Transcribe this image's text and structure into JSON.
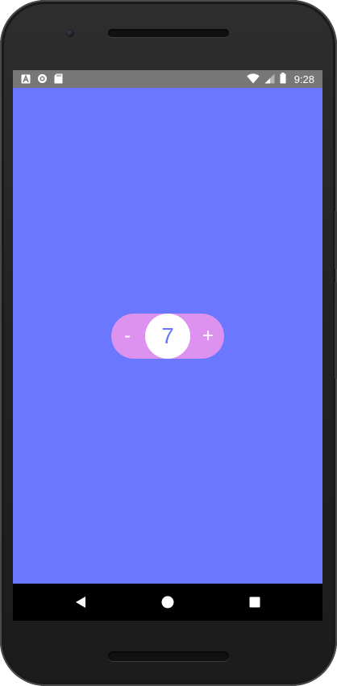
{
  "status_bar": {
    "time": "9:28",
    "left_icons": [
      "text-a-icon",
      "circle-sync-icon",
      "sd-card-icon"
    ],
    "right_icons": [
      "wifi-icon",
      "cell-signal-icon",
      "battery-icon"
    ],
    "background": "#777777"
  },
  "screen": {
    "background": "#6b77fe"
  },
  "stepper": {
    "decrement_label": "-",
    "increment_label": "+",
    "value": "7",
    "background": "#dd92f0",
    "value_color": "#6b77fe"
  },
  "nav_bar": {
    "buttons": [
      "back-icon",
      "home-icon",
      "recents-icon"
    ]
  }
}
